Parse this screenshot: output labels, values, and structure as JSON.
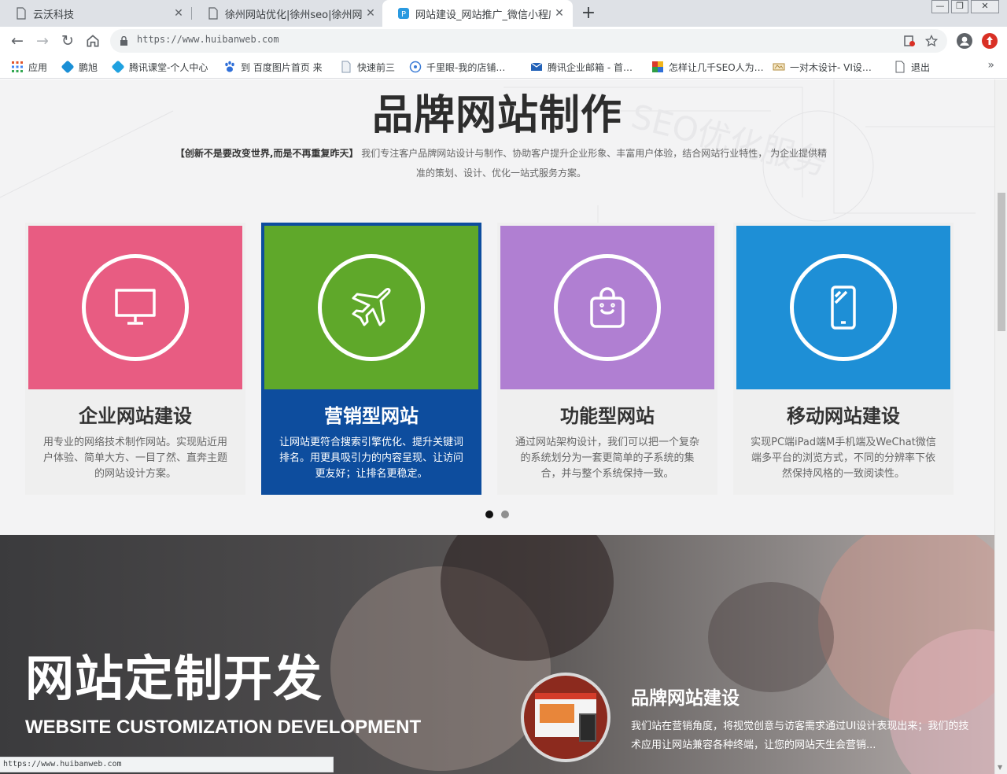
{
  "browser": {
    "tabs": [
      {
        "title": "云沃科技",
        "active": false
      },
      {
        "title": "徐州网站优化|徐州seo|徐州网站",
        "active": false
      },
      {
        "title": "网站建设_网站推广_微信小程序_",
        "active": true
      }
    ],
    "new_tab_symbol": "+",
    "address": "https://www.huibanweb.com",
    "bookmarks": [
      {
        "label": "应用",
        "icon": "apps-grid-icon",
        "color": "#e0542b"
      },
      {
        "label": "鹏旭",
        "icon": "bookmark-site-icon",
        "color": "#1a8fd6"
      },
      {
        "label": "腾讯课堂-个人中心",
        "icon": "tencent-classroom-icon",
        "color": "#1fa1e0"
      },
      {
        "label": "到 百度图片首页 来",
        "icon": "baidu-paw-icon",
        "color": "#2f6fd8"
      },
      {
        "label": "快速前三",
        "icon": "page-icon",
        "color": "#8a9bb0"
      },
      {
        "label": "千里眼-我的店铺…",
        "icon": "compass-icon",
        "color": "#3a7bd5"
      },
      {
        "label": "腾讯企业邮箱 - 首…",
        "icon": "mail-icon",
        "color": "#2262b8"
      },
      {
        "label": "怎样让几千SEO人为…",
        "icon": "colorful-grid-icon",
        "color": "#d93a2a"
      },
      {
        "label": "一对木设计- VI设…",
        "icon": "design-site-icon",
        "color": "#b08a3a"
      },
      {
        "label": "退出",
        "icon": "page-icon",
        "color": "#8a9bb0"
      }
    ],
    "more_symbol": "»",
    "status_url": "https://www.huibanweb.com"
  },
  "page": {
    "section_title": "品牌网站制作",
    "section_desc_bold": "【创新不是要改变世界,而是不再重复昨天】",
    "section_desc_rest": "我们专注客户品牌网站设计与制作、协助客户提升企业形象、丰富用户体验，结合网站行业特性， 为企业提供精准的策划、设计、优化一站式服务方案。",
    "cards": [
      {
        "title": "企业网站建设",
        "text": "用专业的网络技术制作网站。实现贴近用户体验、简单大方、一目了然、直奔主题的网站设计方案。",
        "color": "#e85c82",
        "icon": "monitor-icon",
        "active": false
      },
      {
        "title": "营销型网站",
        "text": "让网站更符合搜索引擎优化、提升关键词排名。用更具吸引力的内容呈现、让访问更友好；让排名更稳定。",
        "color": "#5fa82a",
        "icon": "airplane-icon",
        "active": true
      },
      {
        "title": "功能型网站",
        "text": "通过网站架构设计，我们可以把一个复杂的系统划分为一套更简单的子系统的集合，并与整个系统保持一致。",
        "color": "#b07fd2",
        "icon": "shopping-bag-icon",
        "active": false
      },
      {
        "title": "移动网站建设",
        "text": "实现PC端iPad端M手机端及WeChat微信端多平台的浏览方式，不同的分辨率下依然保持风格的一致阅读性。",
        "color": "#1e8fd6",
        "icon": "mobile-phone-icon",
        "active": false
      }
    ],
    "carousel": {
      "pages": 2,
      "current": 1
    },
    "banner": {
      "title": "网站定制开发",
      "subtitle": "WEBSITE CUSTOMIZATION DEVELOPMENT",
      "feature_title": "品牌网站建设",
      "feature_text": "我们站在营销角度，将视觉创意与访客需求通过UI设计表现出来；我们的技术应用让网站兼容各种终端，让您的网站天生会营销..."
    }
  }
}
